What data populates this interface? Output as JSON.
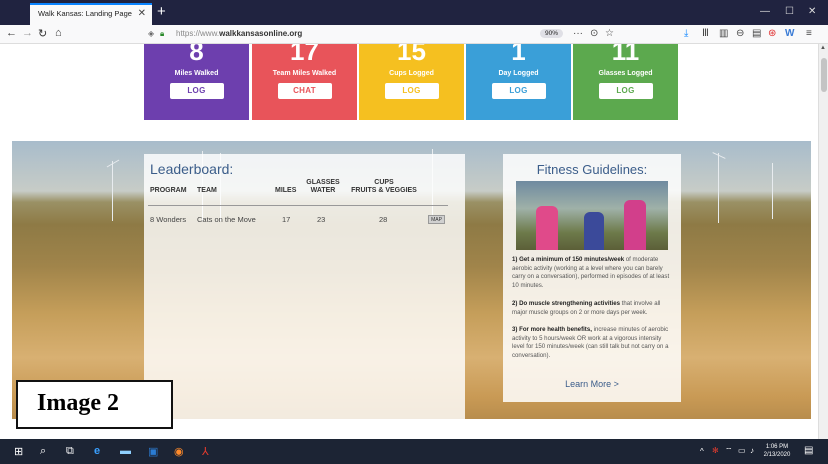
{
  "browser": {
    "tab_title": "Walk Kansas: Landing Page",
    "url_prefix": "https://www.",
    "url_domain": "walkkansasonline.org",
    "zoom": "90%"
  },
  "stats": [
    {
      "number": "8",
      "label": "Miles Walked",
      "button": "LOG",
      "color": "#6d3fae"
    },
    {
      "number": "17",
      "label": "Team Miles Walked",
      "button": "CHAT",
      "color": "#e8545a"
    },
    {
      "number": "15",
      "label": "Cups Logged",
      "button": "LOG",
      "color": "#f5c020"
    },
    {
      "number": "1",
      "label": "Day Logged",
      "button": "LOG",
      "color": "#3a9fd8"
    },
    {
      "number": "11",
      "label": "Glasses Logged",
      "button": "LOG",
      "color": "#5ca94e"
    }
  ],
  "leaderboard": {
    "title": "Leaderboard:",
    "headers": {
      "program": "PROGRAM",
      "team": "TEAM",
      "miles": "MILES",
      "water_1": "GLASSES",
      "water_2": "WATER",
      "cups_1": "CUPS",
      "cups_2": "FRUITS & VEGGIES"
    },
    "rows": [
      {
        "program": "8 Wonders",
        "team": "Cats on the Move",
        "miles": "17",
        "water": "23",
        "cups": "28",
        "map": "MAP"
      }
    ]
  },
  "fitness": {
    "title": "Fitness Guidelines:",
    "items": [
      {
        "bold": "1) Get a minimum of 150 minutes/week",
        "text": " of moderate aerobic activity (working at a level where you can barely carry on a conversation), performed in episodes of at least 10 minutes."
      },
      {
        "bold": "2) Do muscle strengthening activities",
        "text": " that involve all major muscle groups on 2 or more days per week."
      },
      {
        "bold": "3) For more health benefits,",
        "text": " increase minutes of aerobic activity to 5 hours/week OR work at a vigorous intensity level for 150 minutes/week (can still talk but not carry on a conversation)."
      }
    ],
    "learn_more": "Learn More >"
  },
  "overlay_label": "Image 2",
  "taskbar": {
    "time": "1:06 PM",
    "date": "2/13/2020"
  }
}
